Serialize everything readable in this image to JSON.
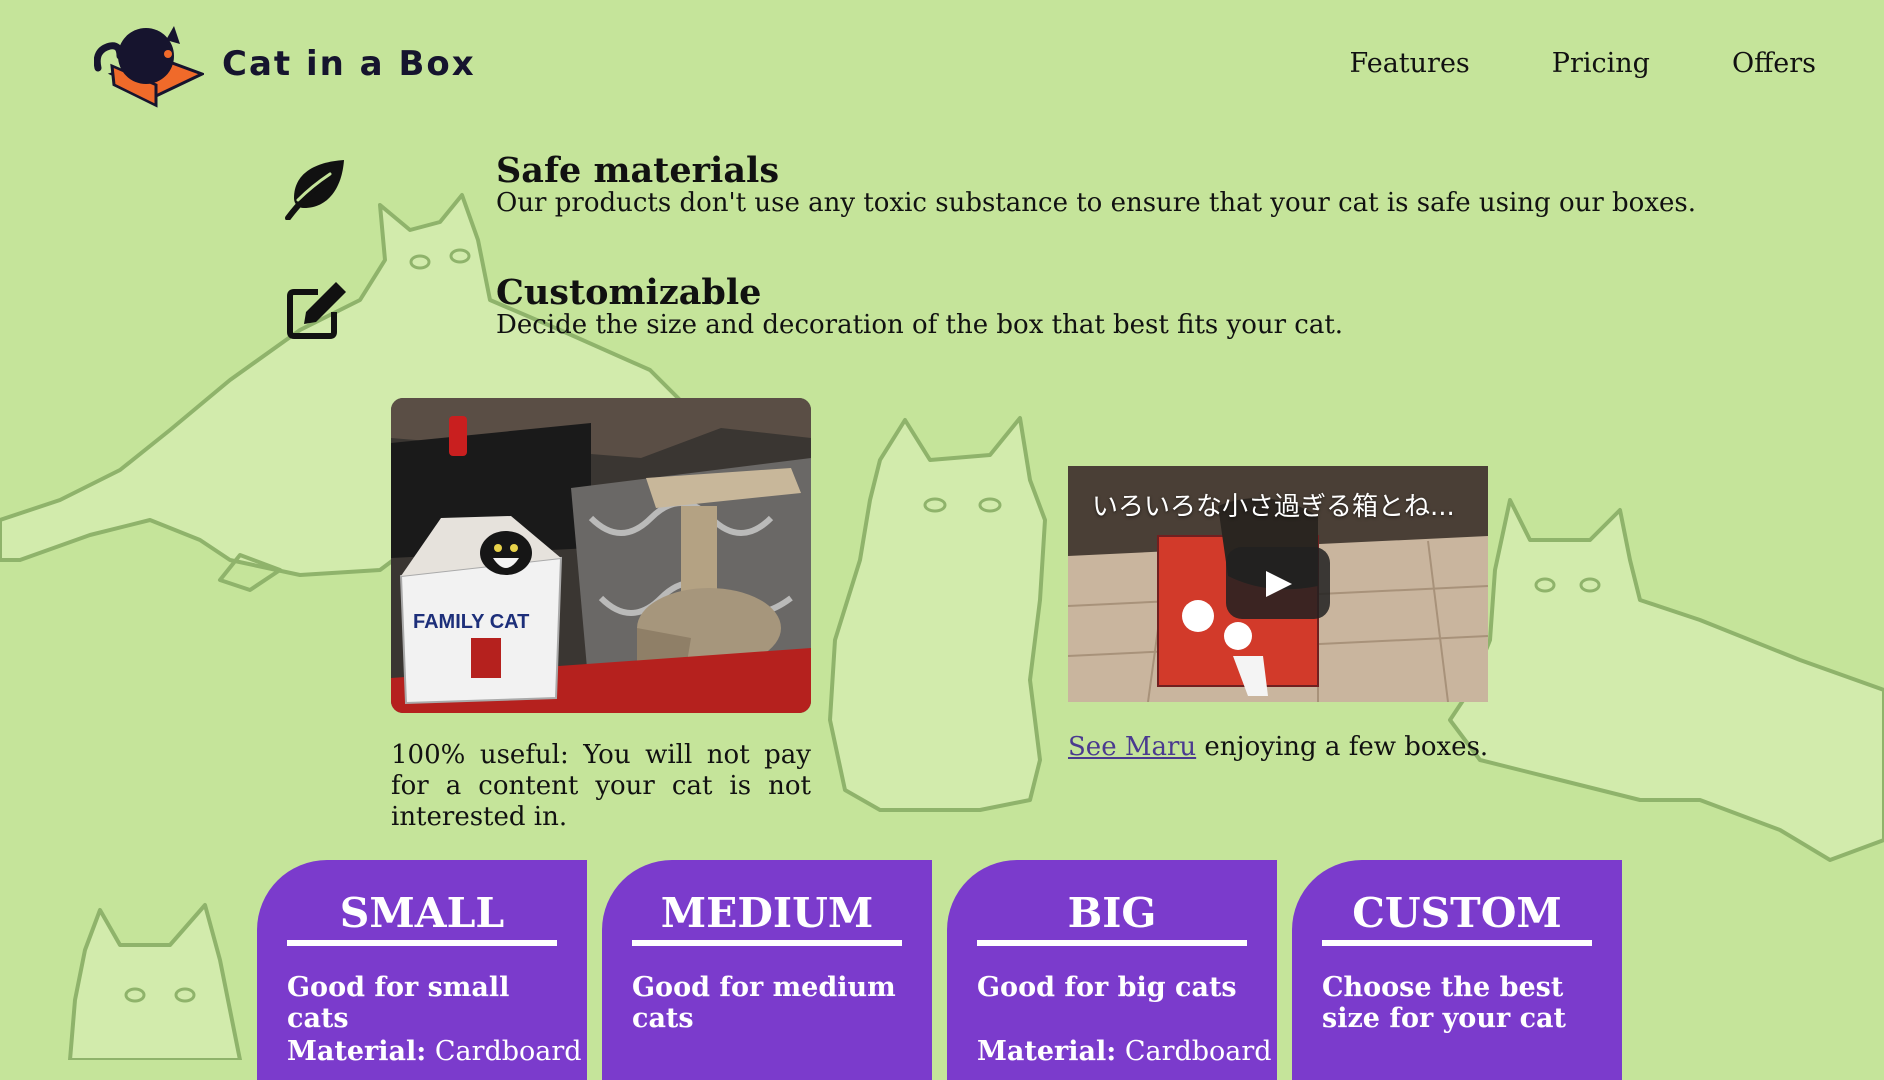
{
  "header": {
    "brand": "Cat in a Box",
    "nav": [
      "Features",
      "Pricing",
      "Offers"
    ]
  },
  "features": [
    {
      "icon": "leaf-icon",
      "title": "Safe materials",
      "description": "Our products don't use any toxic substance to ensure that your cat is safe using our boxes."
    },
    {
      "icon": "edit-icon",
      "title": "Customizable",
      "description": "Decide the size and decoration of the box that best fits your cat."
    }
  ],
  "media": {
    "photo_caption": "100% useful: You will not pay for a content your cat is not interested in.",
    "photo_box_label": "FAMILY CAT",
    "video_title": "いろいろな小さ過ぎる箱とね...",
    "video_link_text": "See Maru",
    "video_caption_rest": " enjoying a few boxes."
  },
  "plans": [
    {
      "title": "SMALL",
      "description": "Good for small cats",
      "material_label": "Material:",
      "material_value": " Cardboard"
    },
    {
      "title": "MEDIUM",
      "description": "Good for medium cats",
      "material_label": "",
      "material_value": ""
    },
    {
      "title": "BIG",
      "description": "Good for big cats",
      "material_label": "Material:",
      "material_value": " Cardboard"
    },
    {
      "title": "CUSTOM",
      "description": "Choose the best size for your cat",
      "material_label": "",
      "material_value": ""
    }
  ],
  "colors": {
    "background": "#c5e49a",
    "cat_outline": "#8fb36b",
    "card": "#7b3bcc",
    "brand_text": "#16142e",
    "logo_box": "#f06a2a",
    "link": "#4a3a8f"
  }
}
